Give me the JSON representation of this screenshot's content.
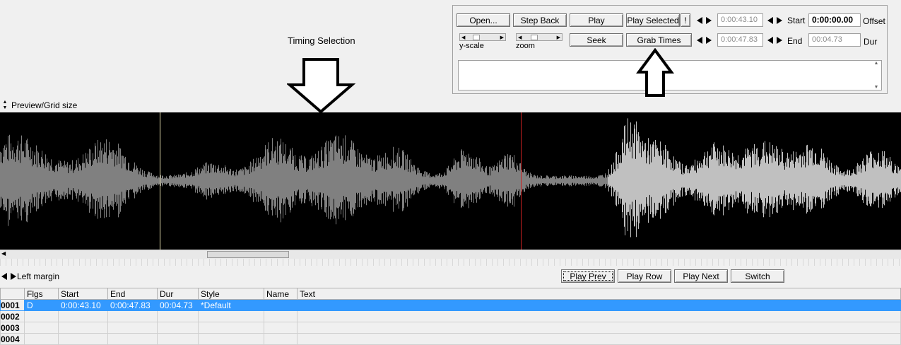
{
  "controls": {
    "open_label": "Open...",
    "step_back_label": "Step Back",
    "play_label": "Play",
    "play_selected_label": "Play Selected",
    "bang_label": "!",
    "seek_label": "Seek",
    "grab_times_label": "Grab Times",
    "yscale_label": "y-scale",
    "zoom_label": "zoom",
    "sel_start_value": "0:00:43.10",
    "sel_end_value": "0:00:47.83",
    "start_label": "Start",
    "end_label": "End",
    "offset_value": "0:00:00.00",
    "offset_label": "Offset",
    "dur_value": "00:04.73",
    "dur_label": "Dur"
  },
  "annotation": {
    "timing_selection_label": "Timing Selection"
  },
  "preview": {
    "grid_size_label": "Preview/Grid size"
  },
  "left_margin_label": "Left margin",
  "row_buttons": {
    "play_prev_label": "Play Prev",
    "play_row_label": "Play Row",
    "play_next_label": "Play Next",
    "switch_label": "Switch"
  },
  "grid": {
    "headers": [
      "",
      "Flgs",
      "Start",
      "End",
      "Dur",
      "Style",
      "Name",
      "Text"
    ],
    "rows": [
      {
        "num": "0001",
        "flags": "D",
        "start": "0:00:43.10",
        "end": "0:00:47.83",
        "dur": "00:04.73",
        "style": "*Default",
        "name": "",
        "text": ""
      },
      {
        "num": "0002",
        "flags": "",
        "start": "",
        "end": "",
        "dur": "",
        "style": "",
        "name": "",
        "text": ""
      },
      {
        "num": "0003",
        "flags": "",
        "start": "",
        "end": "",
        "dur": "",
        "style": "",
        "name": "",
        "text": ""
      },
      {
        "num": "0004",
        "flags": "",
        "start": "",
        "end": "",
        "dur": "",
        "style": "",
        "name": "",
        "text": ""
      }
    ]
  },
  "colors": {
    "waveform_bg": "#000000",
    "waveform_normal": "#808080",
    "waveform_selected": "#c0c0c0",
    "selection_start_marker": "#e8e0b0",
    "playhead_marker": "#cc2222",
    "selected_row": "#3399ff"
  }
}
